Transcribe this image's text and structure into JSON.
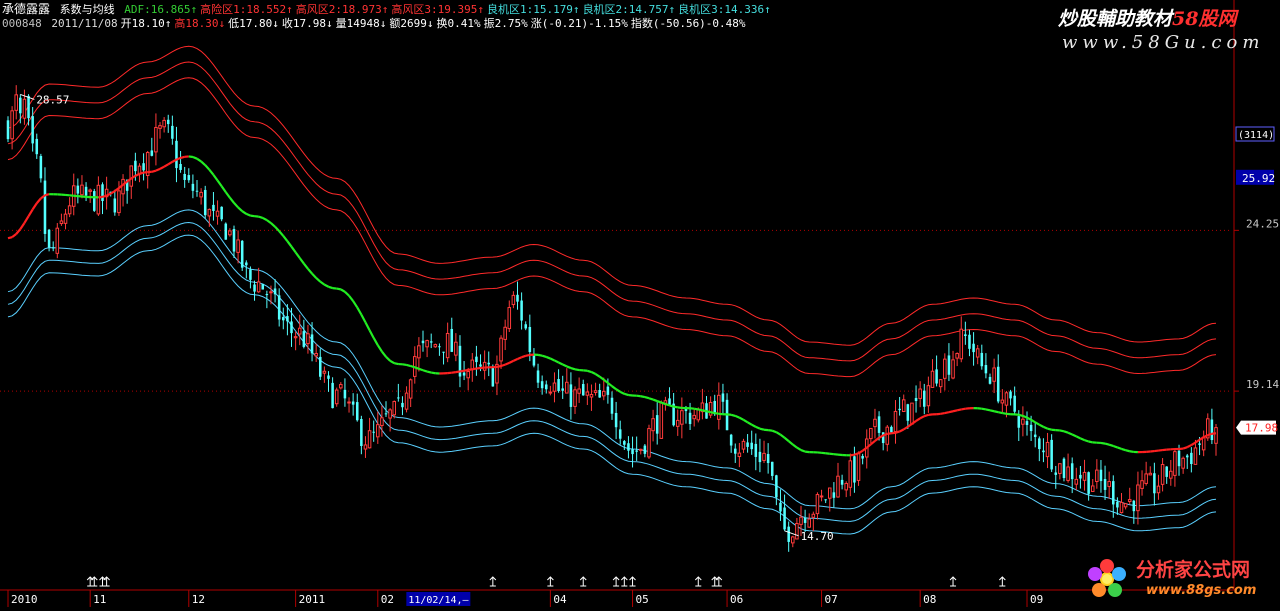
{
  "header": {
    "indicator_name": "承德露露",
    "indicator_sub": "系数与均线",
    "items_line1": [
      {
        "text": "ADF:16.865↑",
        "color": "#33cc33"
      },
      {
        "text": "高险区1:18.552↑",
        "color": "#ff3333"
      },
      {
        "text": "高风区2:18.973↑",
        "color": "#ff3333"
      },
      {
        "text": "高风区3:19.395↑",
        "color": "#ff3333"
      },
      {
        "text": "良机区1:15.179↑",
        "color": "#44dddd"
      },
      {
        "text": "良机区2:14.757↑",
        "color": "#44dddd"
      },
      {
        "text": "良机区3:14.336↑",
        "color": "#44dddd"
      }
    ],
    "stock_code": "000848",
    "items_line2": [
      {
        "text": "2011/11/08",
        "color": "#dddddd"
      },
      {
        "text": "开18.10↑",
        "color": "#ffffff"
      },
      {
        "text": "高18.30↓",
        "color": "#ff3333"
      },
      {
        "text": "低17.80↓",
        "color": "#ffffff"
      },
      {
        "text": "收17.98↓",
        "color": "#ffffff"
      },
      {
        "text": "量14948↓",
        "color": "#ffffff"
      },
      {
        "text": "额2699↓",
        "color": "#ffffff"
      },
      {
        "text": "换0.41%",
        "color": "#ffffff"
      },
      {
        "text": "振2.75%",
        "color": "#ffffff"
      },
      {
        "text": "涨(-0.21)-1.15%",
        "color": "#ffffff"
      },
      {
        "text": "指数(-50.56)-0.48%",
        "color": "#ffffff"
      }
    ]
  },
  "watermarks": {
    "top_main": "炒股輔助教材",
    "top_accent": "58股网",
    "top_url": "www.58Gu.com",
    "bottom_main": "分析家公式网",
    "bottom_url": "www.88gs.com"
  },
  "colors": {
    "background": "#000000",
    "up_candle": "#ff3b3b",
    "down_candle": "#54ffff",
    "ma_up": "#ff2020",
    "ma_down": "#22ee22",
    "high_bands": "#ff2a2a",
    "low_bands": "#5ad0ff",
    "axis": "#b00000",
    "cursor_box": "#0000aa"
  },
  "chart_data": {
    "type": "candlestick",
    "x_labels": [
      "2010",
      "11",
      "12",
      "2011",
      "02",
      "04",
      "05",
      "06",
      "07",
      "08",
      "09"
    ],
    "x_label_index": [
      0,
      20,
      44,
      70,
      90,
      132,
      152,
      175,
      198,
      222,
      248
    ],
    "cursor_label": "11/02/14,—",
    "cursor_index": 95,
    "y_ticks": [
      {
        "value": 24.25,
        "label": "24.25"
      },
      {
        "value": 19.14,
        "label": "19.14"
      }
    ],
    "last_price_label": "17.98",
    "last_price": 17.98,
    "counter_label": "(3114)",
    "cursor_price_label": "25.92",
    "cursor_price": 25.92,
    "high_label": "28.57",
    "high_value": 28.57,
    "high_index": 3,
    "low_label": "14.70",
    "low_value": 14.7,
    "low_index": 189,
    "ylim": [
      13.2,
      30.3
    ],
    "num_bars": 295,
    "trend_anchors": [
      [
        0,
        24.0
      ],
      [
        10,
        25.4
      ],
      [
        22,
        25.3
      ],
      [
        34,
        26.1
      ],
      [
        44,
        26.6
      ],
      [
        60,
        24.7
      ],
      [
        80,
        22.4
      ],
      [
        95,
        20.0
      ],
      [
        105,
        19.7
      ],
      [
        118,
        19.9
      ],
      [
        128,
        20.3
      ],
      [
        140,
        19.8
      ],
      [
        152,
        19.0
      ],
      [
        165,
        18.6
      ],
      [
        175,
        18.4
      ],
      [
        185,
        17.9
      ],
      [
        195,
        17.2
      ],
      [
        205,
        17.1
      ],
      [
        215,
        17.8
      ],
      [
        225,
        18.4
      ],
      [
        235,
        18.6
      ],
      [
        245,
        18.4
      ],
      [
        255,
        17.9
      ],
      [
        265,
        17.5
      ],
      [
        275,
        17.2
      ],
      [
        285,
        17.3
      ],
      [
        294,
        17.8
      ]
    ],
    "price_anchors": [
      [
        0,
        27.6
      ],
      [
        3,
        28.57
      ],
      [
        7,
        26.3
      ],
      [
        10,
        23.5
      ],
      [
        16,
        25.3
      ],
      [
        26,
        25.2
      ],
      [
        32,
        26.5
      ],
      [
        38,
        27.4
      ],
      [
        44,
        25.6
      ],
      [
        52,
        24.4
      ],
      [
        60,
        22.6
      ],
      [
        70,
        21.0
      ],
      [
        80,
        19.0
      ],
      [
        88,
        17.6
      ],
      [
        94,
        18.4
      ],
      [
        100,
        20.4
      ],
      [
        106,
        20.7
      ],
      [
        112,
        19.8
      ],
      [
        118,
        19.7
      ],
      [
        123,
        22.0
      ],
      [
        130,
        19.6
      ],
      [
        136,
        19.0
      ],
      [
        146,
        18.8
      ],
      [
        152,
        17.2
      ],
      [
        160,
        18.4
      ],
      [
        168,
        18.4
      ],
      [
        172,
        18.8
      ],
      [
        178,
        17.4
      ],
      [
        184,
        17.1
      ],
      [
        189,
        14.7
      ],
      [
        195,
        15.4
      ],
      [
        205,
        16.5
      ],
      [
        212,
        17.9
      ],
      [
        220,
        18.6
      ],
      [
        228,
        20.0
      ],
      [
        233,
        20.8
      ],
      [
        238,
        19.8
      ],
      [
        244,
        18.6
      ],
      [
        250,
        17.6
      ],
      [
        258,
        16.6
      ],
      [
        266,
        16.2
      ],
      [
        272,
        15.6
      ],
      [
        278,
        16.1
      ],
      [
        286,
        17.0
      ],
      [
        294,
        17.98
      ]
    ],
    "band_offsets_up": [
      2.5,
      3.0,
      3.5
    ],
    "band_offsets_down": [
      -1.7,
      -2.1,
      -2.5
    ],
    "up_arrow_indices": [
      20,
      21,
      23,
      24,
      118,
      132,
      140,
      148,
      150,
      152,
      168,
      172,
      173,
      230,
      242
    ]
  }
}
